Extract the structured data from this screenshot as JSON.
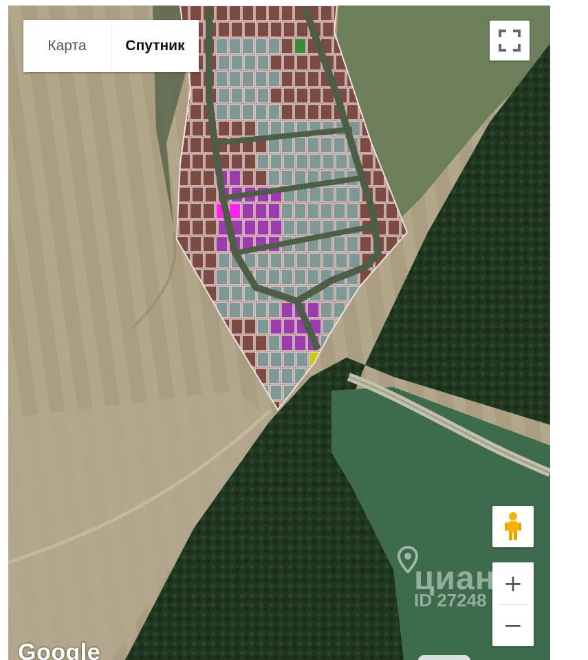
{
  "map_type": {
    "map_label": "Карта",
    "satellite_label": "Спутник",
    "active": "satellite"
  },
  "controls": {
    "fullscreen_icon": "fullscreen-icon",
    "pegman_icon": "pegman-icon",
    "zoom_in_label": "+",
    "zoom_out_label": "−"
  },
  "attribution": {
    "logo_text": "Google"
  },
  "watermark": {
    "brand": "циан",
    "id_text": "ID 27248"
  },
  "colors": {
    "plot_default": "#7a4a43",
    "plot_gray": "#7f9896",
    "plot_purple": "#9a3cab",
    "plot_magenta": "#ff22f0",
    "plot_green": "#3c8a3c",
    "plot_yellow": "#c8c818",
    "plot_outline": "#f2dede",
    "forest": "#1e3520",
    "meadow": "#3e6e4e",
    "field": "#b0a48a"
  }
}
